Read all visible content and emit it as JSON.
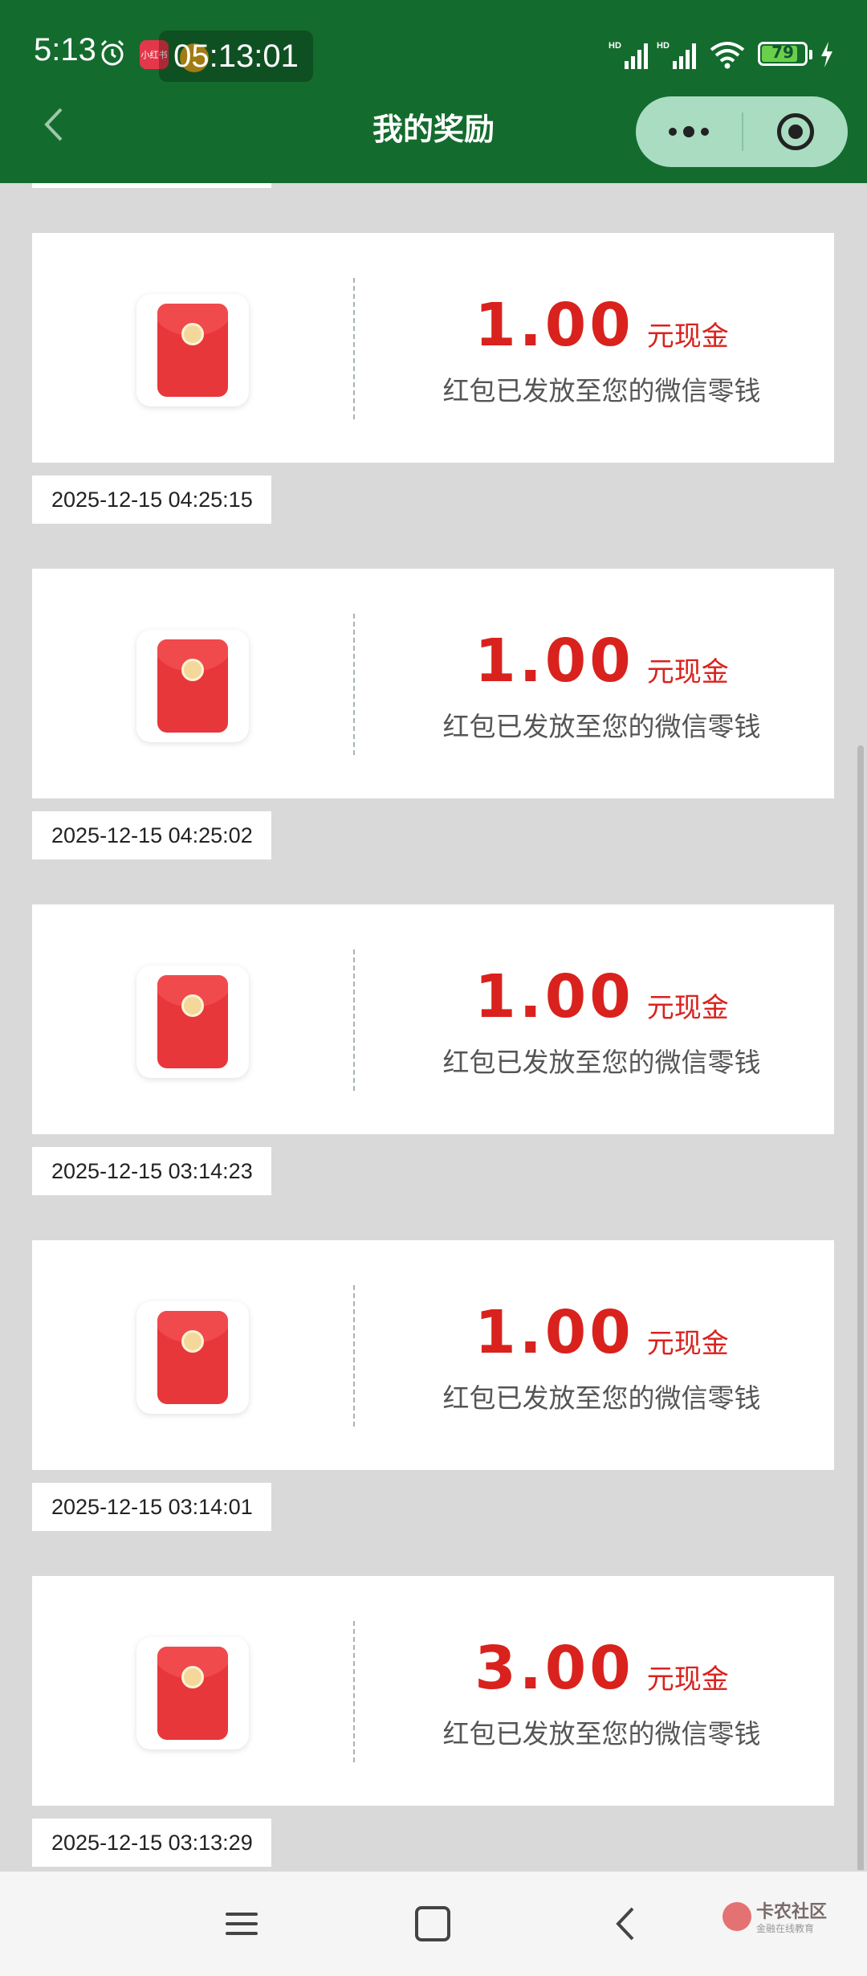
{
  "status_bar": {
    "time": "5:13",
    "clock_overlay": "05:13:01",
    "app_badge": "小红书",
    "battery": "79"
  },
  "header": {
    "title": "我的奖励"
  },
  "rewards": [
    {
      "amount": "1.00",
      "unit": "元现金",
      "desc": "红包已发放至您的微信零钱",
      "date": "2025-12-15 04:25:15"
    },
    {
      "amount": "1.00",
      "unit": "元现金",
      "desc": "红包已发放至您的微信零钱",
      "date": "2025-12-15 04:25:02"
    },
    {
      "amount": "1.00",
      "unit": "元现金",
      "desc": "红包已发放至您的微信零钱",
      "date": "2025-12-15 03:14:23"
    },
    {
      "amount": "1.00",
      "unit": "元现金",
      "desc": "红包已发放至您的微信零钱",
      "date": "2025-12-15 03:14:01"
    },
    {
      "amount": "3.00",
      "unit": "元现金",
      "desc": "红包已发放至您的微信零钱",
      "date": "2025-12-15 03:13:29"
    }
  ],
  "watermark": {
    "title": "卡农社区",
    "subtitle": "金融在线教育"
  },
  "colors": {
    "header_bg": "#146b2e",
    "amount": "#d9221d",
    "page_bg": "#d9d9d9"
  }
}
